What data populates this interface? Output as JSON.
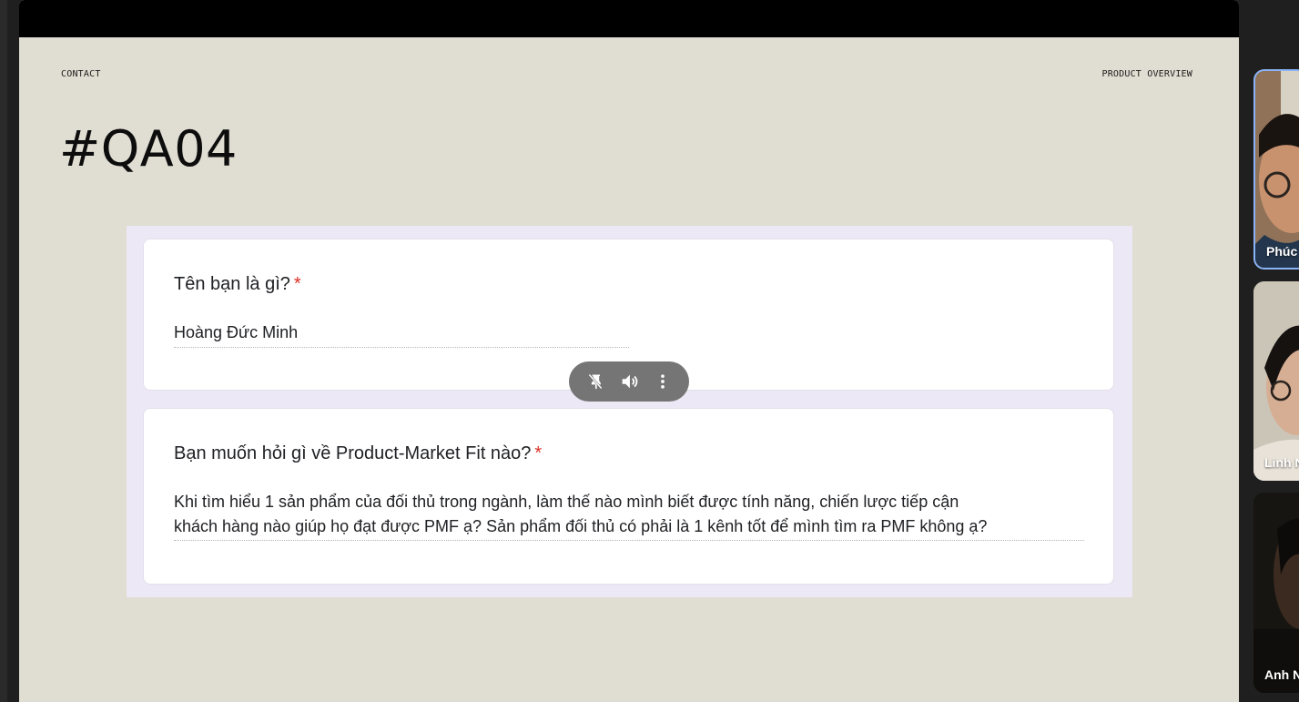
{
  "slide": {
    "nav_left": "CONTACT",
    "nav_right": "PRODUCT OVERVIEW",
    "title": "#QA04"
  },
  "form": {
    "questions": [
      {
        "title": "Tên bạn là gì?",
        "required_mark": "*",
        "answer": "Hoàng Đức Minh"
      },
      {
        "title": "Bạn muốn hỏi gì về Product-Market Fit nào?",
        "required_mark": "*",
        "answer_line1": "Khi tìm hiểu 1 sản phẩm của đối thủ trong ngành, làm thế nào mình biết được tính năng, chiến lược tiếp cận",
        "answer_line2": "khách hàng nào giúp họ đạt được PMF ạ? Sản phẩm đối thủ có phải là 1 kênh tốt để mình tìm ra PMF không ạ?"
      }
    ]
  },
  "controls": {
    "icons": [
      "unpin-icon",
      "volume-icon",
      "more-options-icon"
    ]
  },
  "participants": [
    {
      "name": "Phúc"
    },
    {
      "name": "Linh N"
    },
    {
      "name": "Anh N"
    }
  ],
  "colors": {
    "slide_bg": "#e0ddd2",
    "form_bg": "#ede8f5",
    "required": "#d93025",
    "active_speaker": "#8ab4f8"
  }
}
